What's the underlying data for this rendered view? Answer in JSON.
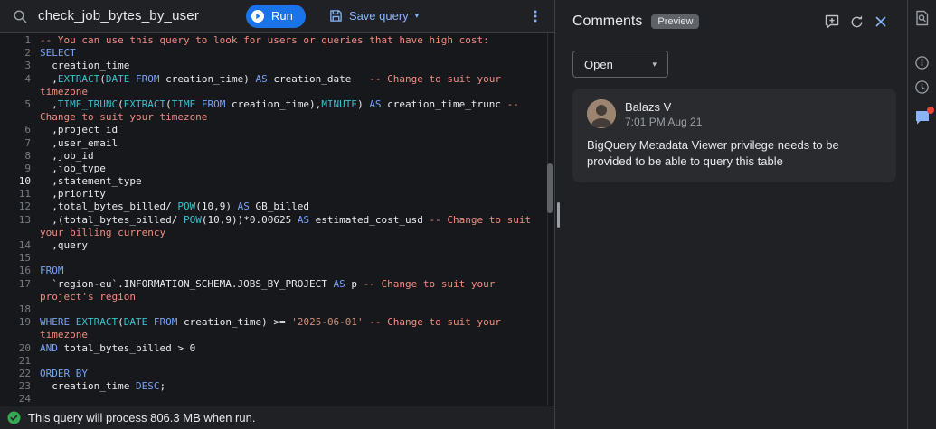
{
  "topbar": {
    "title": "check_job_bytes_by_user",
    "run_label": "Run",
    "save_label": "Save query"
  },
  "editor": {
    "active_line": "10",
    "lines": [
      {
        "n": "1",
        "tokens": [
          [
            "com",
            "-- You can use this query to look for users or queries that have high cost:"
          ]
        ]
      },
      {
        "n": "2",
        "tokens": [
          [
            "kw",
            "SELECT"
          ]
        ]
      },
      {
        "n": "3",
        "tokens": [
          [
            "txt",
            "  creation_time"
          ]
        ]
      },
      {
        "n": "4",
        "tokens": [
          [
            "txt",
            "  ,"
          ],
          [
            "fn",
            "EXTRACT"
          ],
          [
            "txt",
            "("
          ],
          [
            "fn",
            "DATE"
          ],
          [
            "txt",
            " "
          ],
          [
            "kw",
            "FROM"
          ],
          [
            "txt",
            " creation_time) "
          ],
          [
            "kw",
            "AS"
          ],
          [
            "txt",
            " creation_date   "
          ],
          [
            "com",
            "-- Change to suit your"
          ]
        ]
      },
      {
        "n": "",
        "tokens": [
          [
            "com",
            "timezone"
          ]
        ]
      },
      {
        "n": "5",
        "tokens": [
          [
            "txt",
            "  ,"
          ],
          [
            "fn",
            "TIME_TRUNC"
          ],
          [
            "txt",
            "("
          ],
          [
            "fn",
            "EXTRACT"
          ],
          [
            "txt",
            "("
          ],
          [
            "fn",
            "TIME"
          ],
          [
            "txt",
            " "
          ],
          [
            "kw",
            "FROM"
          ],
          [
            "txt",
            " creation_time),"
          ],
          [
            "fn",
            "MINUTE"
          ],
          [
            "txt",
            ") "
          ],
          [
            "kw",
            "AS"
          ],
          [
            "txt",
            " creation_time_trunc "
          ],
          [
            "com",
            "--"
          ]
        ]
      },
      {
        "n": "",
        "tokens": [
          [
            "com",
            "Change to suit your timezone"
          ]
        ]
      },
      {
        "n": "6",
        "tokens": [
          [
            "txt",
            "  ,project_id"
          ]
        ]
      },
      {
        "n": "7",
        "tokens": [
          [
            "txt",
            "  ,user_email"
          ]
        ]
      },
      {
        "n": "8",
        "tokens": [
          [
            "txt",
            "  ,job_id"
          ]
        ]
      },
      {
        "n": "9",
        "tokens": [
          [
            "txt",
            "  ,job_type"
          ]
        ]
      },
      {
        "n": "10",
        "tokens": [
          [
            "txt",
            "  ,statement_type"
          ]
        ]
      },
      {
        "n": "11",
        "tokens": [
          [
            "txt",
            "  ,priority"
          ]
        ]
      },
      {
        "n": "12",
        "tokens": [
          [
            "txt",
            "  ,total_bytes_billed/ "
          ],
          [
            "fn",
            "POW"
          ],
          [
            "txt",
            "("
          ],
          [
            "num",
            "10"
          ],
          [
            "txt",
            ","
          ],
          [
            "num",
            "9"
          ],
          [
            "txt",
            ") "
          ],
          [
            "kw",
            "AS"
          ],
          [
            "txt",
            " GB_billed"
          ]
        ]
      },
      {
        "n": "13",
        "tokens": [
          [
            "txt",
            "  ,(total_bytes_billed/ "
          ],
          [
            "fn",
            "POW"
          ],
          [
            "txt",
            "("
          ],
          [
            "num",
            "10"
          ],
          [
            "txt",
            ","
          ],
          [
            "num",
            "9"
          ],
          [
            "txt",
            "))*"
          ],
          [
            "num",
            "0.00625"
          ],
          [
            "txt",
            " "
          ],
          [
            "kw",
            "AS"
          ],
          [
            "txt",
            " estimated_cost_usd "
          ],
          [
            "com",
            "-- Change to suit"
          ]
        ]
      },
      {
        "n": "",
        "tokens": [
          [
            "com",
            "your billing currency"
          ]
        ]
      },
      {
        "n": "14",
        "tokens": [
          [
            "txt",
            "  ,query"
          ]
        ]
      },
      {
        "n": "15",
        "tokens": []
      },
      {
        "n": "16",
        "tokens": [
          [
            "kw",
            "FROM"
          ]
        ]
      },
      {
        "n": "17",
        "tokens": [
          [
            "txt",
            "  `region-eu`.INFORMATION_SCHEMA.JOBS_BY_PROJECT "
          ],
          [
            "kw",
            "AS"
          ],
          [
            "txt",
            " p "
          ],
          [
            "com",
            "-- Change to suit your"
          ]
        ]
      },
      {
        "n": "",
        "tokens": [
          [
            "com",
            "project's region"
          ]
        ]
      },
      {
        "n": "18",
        "tokens": []
      },
      {
        "n": "19",
        "tokens": [
          [
            "kw",
            "WHERE"
          ],
          [
            "txt",
            " "
          ],
          [
            "fn",
            "EXTRACT"
          ],
          [
            "txt",
            "("
          ],
          [
            "fn",
            "DATE"
          ],
          [
            "txt",
            " "
          ],
          [
            "kw",
            "FROM"
          ],
          [
            "txt",
            " creation_time) >= "
          ],
          [
            "str",
            "'2025-06-01'"
          ],
          [
            "txt",
            " "
          ],
          [
            "com",
            "-- Change to suit your"
          ]
        ]
      },
      {
        "n": "",
        "tokens": [
          [
            "com",
            "timezone"
          ]
        ]
      },
      {
        "n": "20",
        "tokens": [
          [
            "kw",
            "AND"
          ],
          [
            "txt",
            " total_bytes_billed > "
          ],
          [
            "num",
            "0"
          ]
        ]
      },
      {
        "n": "21",
        "tokens": []
      },
      {
        "n": "22",
        "tokens": [
          [
            "kw",
            "ORDER BY"
          ]
        ]
      },
      {
        "n": "23",
        "tokens": [
          [
            "txt",
            "  creation_time "
          ],
          [
            "kw",
            "DESC"
          ],
          [
            "txt",
            ";"
          ]
        ]
      },
      {
        "n": "24",
        "tokens": []
      }
    ]
  },
  "statusbar": {
    "message": "This query will process 806.3 MB when run."
  },
  "comments_panel": {
    "title": "Comments",
    "badge": "Preview",
    "filter": {
      "selected": "Open"
    },
    "comments": [
      {
        "author": "Balazs V",
        "timestamp": "7:01 PM Aug 21",
        "body": "BigQuery Metadata Viewer privilege needs to be provided to be able to query this table"
      }
    ]
  },
  "icons": {
    "caret": "▾"
  },
  "colors": {
    "accent_blue": "#8ab4f8",
    "run_blue": "#1a73e8",
    "keyword": "#7aa2f7",
    "function": "#3ac1cc",
    "comment": "#f28b82",
    "string": "#ce9178",
    "success_green": "#34a853",
    "notification_red": "#ea4335"
  }
}
